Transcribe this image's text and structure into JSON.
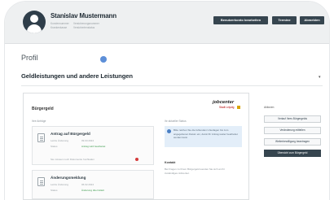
{
  "user": {
    "name": "Stanislav Mustermann",
    "meta_col1": [
      "Kundennummer",
      "Krankenkasse"
    ],
    "meta_col2": [
      "Versicherungsnummer",
      "Versichertenstatus"
    ]
  },
  "top_actions": [
    "Benutzerkonto bearbeiten",
    "Termine",
    "Abmelden"
  ],
  "page": {
    "title": "Profil",
    "section_title": "Geldleistungen und andere Leistungen"
  },
  "panel": {
    "title": "Bürgergeld",
    "logo_text": "jobcenter",
    "logo_sub": "Stadt Leipzig",
    "col_left_label": "Ihre Anträge",
    "col_right_label": "Ihr aktueller Status",
    "cards": [
      {
        "title": "Antrag auf Bürgergeld",
        "rows": [
          {
            "k": "Letzte Änderung",
            "v": "09.03.2024",
            "green": false
          },
          {
            "k": "Status",
            "v": "Antrag wird bearbeitet",
            "green": true
          }
        ],
        "footer": "Sie müssen noch Dokumente hochladen"
      },
      {
        "title": "Änderungsmeldung",
        "rows": [
          {
            "k": "Letzte Änderung",
            "v": "06.02.2024",
            "green": false
          },
          {
            "k": "Status",
            "v": "Änderung übermittelt",
            "green": true
          }
        ]
      }
    ],
    "info_text": "Bitte reichen Sie die fehlenden Unterlagen bis zum angegebenen Datum ein, damit Ihr Antrag weiter bearbeitet werden kann.",
    "contact_title": "Kontakt",
    "contact_text": "Bei Fragen zu Ihrem Bürgergeld wenden Sie sich an Ihr zuständiges Jobcenter."
  },
  "sidebar": {
    "label": "Aktionen",
    "buttons": [
      {
        "label": "Verlauf Ihres Bürgergelds",
        "primary": false
      },
      {
        "label": "Veränderung mitteilen",
        "primary": false
      },
      {
        "label": "Weiterbewilligung beantragen",
        "primary": false
      },
      {
        "label": "Übersicht zum Bürgergeld",
        "primary": true
      }
    ]
  },
  "colors": {
    "topbar": "#eef0f1",
    "dark_button": "#36454f",
    "status_green": "#3a9a4b",
    "alert_red": "#d43a3a",
    "info_bg": "#e3eef9",
    "accent_blue": "#5d8fd8"
  }
}
